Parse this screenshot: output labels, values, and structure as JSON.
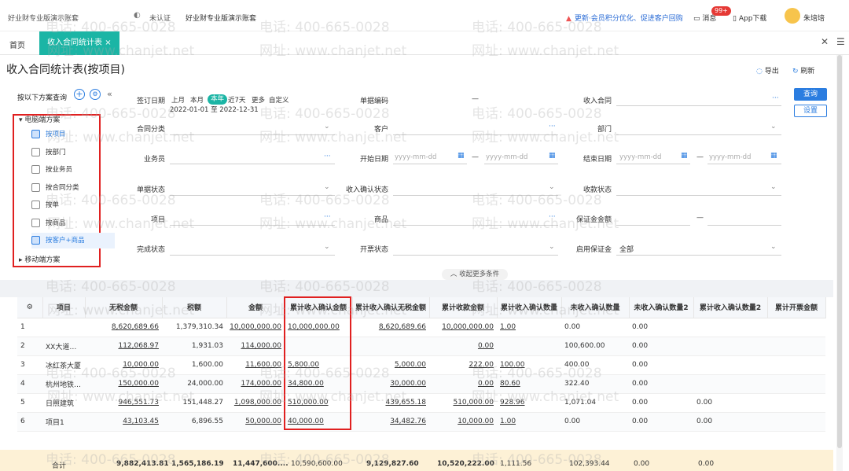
{
  "topbar": {
    "company": "好业财专业版演示账套",
    "auth": "未认证",
    "edition": "好业财专业版演示账套",
    "notice": "更新·会员积分优化、促进客户回购",
    "messages": "消息",
    "badge": "99+",
    "app_download": "App下载",
    "user": "朱培培"
  },
  "tabs": {
    "home": "首页",
    "active": "收入合同统计表",
    "close": "×"
  },
  "page": {
    "title": "收入合同统计表(按项目)",
    "export": "导出",
    "refresh": "刷新"
  },
  "sidebar": {
    "heading": "按以下方案查询",
    "group1": "电脑端方案",
    "items": [
      {
        "label": "按项目"
      },
      {
        "label": "按部门"
      },
      {
        "label": "按业务员"
      },
      {
        "label": "按合同分类"
      },
      {
        "label": "按单"
      },
      {
        "label": "按商品"
      },
      {
        "label": "按客户+商品"
      }
    ],
    "group2": "移动端方案"
  },
  "filters": {
    "sign_date": "签订日期",
    "periods": [
      "上月",
      "本月",
      "本年",
      "近7天",
      "更多",
      "自定义"
    ],
    "date_range": "2022-01-01 至 2022-12-31",
    "doc_no": "单据编码",
    "doc_no_dash": "—",
    "income_contract": "收入合同",
    "contract_class": "合同分类",
    "customer": "客户",
    "dept": "部门",
    "salesman": "业务员",
    "start_date": "开始日期",
    "end_date": "结束日期",
    "date_ph": "yyyy-mm-dd",
    "doc_status": "单据状态",
    "income_confirm_status": "收入确认状态",
    "collect_status": "收款状态",
    "project": "项目",
    "product": "商品",
    "deposit_amount": "保证金金额",
    "complete_status": "完成状态",
    "invoice_status": "开票状态",
    "enable_deposit": "启用保证金",
    "enable_deposit_value": "全部",
    "query_btn": "查询",
    "settings_btn": "设置",
    "collapse": "收起更多条件"
  },
  "table": {
    "headers": [
      "项目",
      "无税金额",
      "税额",
      "金额",
      "累计收入确认金额",
      "累计收入确认无税金额",
      "累计收款金额",
      "累计收入确认数量",
      "未收入确认数量",
      "未收入确认数量2",
      "累计收入确认数量2",
      "累计开票金额"
    ],
    "rows": [
      [
        "1",
        "",
        "8,620,689.66",
        "1,379,310.34",
        "10,000,000.00",
        "10,000,000.00",
        "8,620,689.66",
        "10,000,000.00",
        "1.00",
        "0.00",
        "0.00",
        "",
        ""
      ],
      [
        "2",
        "XX大道工程",
        "112,068.97",
        "1,931.03",
        "114,000.00",
        "",
        "",
        "0.00",
        "",
        "100,600.00",
        "0.00",
        "",
        ""
      ],
      [
        "3",
        "冰红茶大厦",
        "10,000.00",
        "1,600.00",
        "11,600.00",
        "5,800.00",
        "5,000.00",
        "222.00",
        "100.00",
        "400.00",
        "0.00",
        "",
        ""
      ],
      [
        "4",
        "杭州地铁9号...",
        "150,000.00",
        "24,000.00",
        "174,000.00",
        "34,800.00",
        "30,000.00",
        "0.00",
        "80.60",
        "322.40",
        "0.00",
        "",
        ""
      ],
      [
        "5",
        "日照建筑",
        "946,551.73",
        "151,448.27",
        "1,098,000.00",
        "510,000.00",
        "439,655.18",
        "510,000.00",
        "928.96",
        "1,071.04",
        "0.00",
        "0.00",
        ""
      ],
      [
        "6",
        "项目1",
        "43,103.45",
        "6,896.55",
        "50,000.00",
        "40,000.00",
        "34,482.76",
        "10,000.00",
        "1.00",
        "0.00",
        "0.00",
        "0.00",
        ""
      ]
    ],
    "totals": {
      "label": "合计",
      "wushui": "9,882,413.81",
      "tax": "1,565,186.19",
      "amount": "11,447,600....",
      "confirm": "10,590,600.00",
      "confirm_wushui": "9,129,827.60",
      "collected": "10,520,222.00",
      "confirm_qty": "1,111.56",
      "unconfirmed_qty": "102,393.44",
      "unconfirmed_qty2": "0.00",
      "confirm_qty2": "0.00"
    }
  },
  "watermark": {
    "phone": "电话: 400-665-0028",
    "site": "网址: www.chanjet.net"
  },
  "colors": {
    "accent": "#1bb5a5",
    "link": "#2b7de0",
    "highlight_box": "#e02020",
    "total_bg": "#fdf1d6"
  }
}
